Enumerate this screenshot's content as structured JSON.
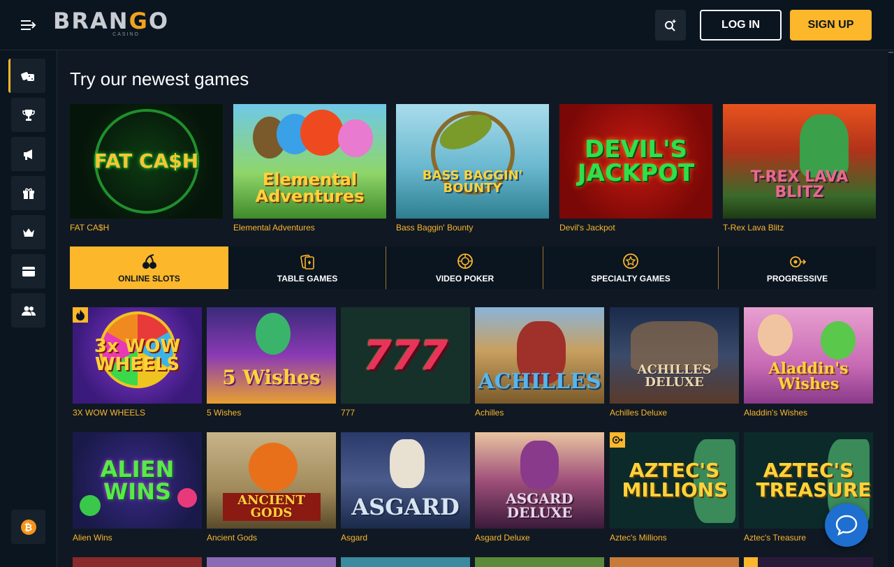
{
  "header": {
    "logo_main_1": "BRAN",
    "logo_main_2": "G",
    "logo_main_3": "O",
    "logo_sub": "CASINO",
    "login_label": "LOG IN",
    "signup_label": "SIGN UP"
  },
  "sidebar": {
    "items": [
      {
        "icon": "dice-icon",
        "active": true
      },
      {
        "icon": "trophy-icon",
        "active": false
      },
      {
        "icon": "megaphone-icon",
        "active": false
      },
      {
        "icon": "gift-icon",
        "active": false
      },
      {
        "icon": "crown-icon",
        "active": false
      },
      {
        "icon": "card-icon",
        "active": false
      },
      {
        "icon": "users-icon",
        "active": false
      }
    ],
    "crypto_symbol": "₿"
  },
  "newest": {
    "title": "Try our newest games",
    "games": [
      {
        "name": "FAT CA$H",
        "art": "FAT CA$H"
      },
      {
        "name": "Elemental Adventures",
        "art": "Elemental Adventures"
      },
      {
        "name": "Bass Baggin' Bounty",
        "art": "BASS BAGGIN' BOUNTY"
      },
      {
        "name": "Devil's Jackpot",
        "art": "DEVIL'S JACKPOT"
      },
      {
        "name": "T-Rex Lava Blitz",
        "art": "T-REX LAVA BLITZ"
      }
    ]
  },
  "tabs": [
    {
      "label": "ONLINE SLOTS",
      "icon": "cherries-icon",
      "active": true
    },
    {
      "label": "TABLE GAMES",
      "icon": "cards-icon",
      "active": false
    },
    {
      "label": "VIDEO POKER",
      "icon": "chip-icon",
      "active": false
    },
    {
      "label": "SPECIALTY GAMES",
      "icon": "star-icon",
      "active": false
    },
    {
      "label": "PROGRESSIVE",
      "icon": "progressive-icon",
      "active": false
    }
  ],
  "games": [
    {
      "name": "3X WOW WHEELS",
      "art": "3x WOW WHEELS",
      "badge": "fire"
    },
    {
      "name": "5 Wishes",
      "art": "5 Wishes",
      "badge": ""
    },
    {
      "name": "777",
      "art": "777",
      "badge": ""
    },
    {
      "name": "Achilles",
      "art": "ACHILLES",
      "badge": ""
    },
    {
      "name": "Achilles Deluxe",
      "art": "ACHILLES DELUXE",
      "badge": ""
    },
    {
      "name": "Aladdin's Wishes",
      "art": "Aladdin's Wishes",
      "badge": ""
    },
    {
      "name": "Alien Wins",
      "art": "ALIEN WINS",
      "badge": ""
    },
    {
      "name": "Ancient Gods",
      "art": "ANCIENT GODS",
      "badge": ""
    },
    {
      "name": "Asgard",
      "art": "ASGARD",
      "badge": ""
    },
    {
      "name": "Asgard Deluxe",
      "art": "ASGARD DELUXE",
      "badge": ""
    },
    {
      "name": "Aztec's Millions",
      "art": "AZTEC'S MILLIONS",
      "badge": "progressive"
    },
    {
      "name": "Aztec's Treasure",
      "art": "AZTEC'S TREASURE",
      "badge": ""
    }
  ],
  "colors": {
    "accent": "#fcb72b",
    "background": "#101923",
    "header": "#0b1520",
    "chat": "#1f6fd1"
  }
}
